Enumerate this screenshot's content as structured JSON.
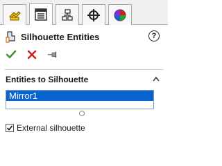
{
  "tabs": [
    {
      "name": "feature-manager",
      "icon": "feature-manager-icon"
    },
    {
      "name": "property-manager",
      "icon": "property-manager-icon",
      "active": true
    },
    {
      "name": "configuration-manager",
      "icon": "configuration-manager-icon"
    },
    {
      "name": "dimxpert-manager",
      "icon": "dimxpert-icon"
    },
    {
      "name": "display-manager",
      "icon": "display-manager-icon"
    }
  ],
  "header": {
    "title": "Silhouette Entities",
    "help_label": "?"
  },
  "actions": {
    "ok": "check-icon",
    "cancel": "x-icon",
    "pin": "pushpin-icon"
  },
  "group": {
    "title": "Entities to Silhouette",
    "items": [
      "Mirror1"
    ]
  },
  "options": {
    "external_silhouette_label": "External silhouette",
    "external_silhouette_checked": true
  },
  "colors": {
    "selection": "#0a64cf",
    "ok": "#3a9a25",
    "cancel": "#d11a1a"
  }
}
